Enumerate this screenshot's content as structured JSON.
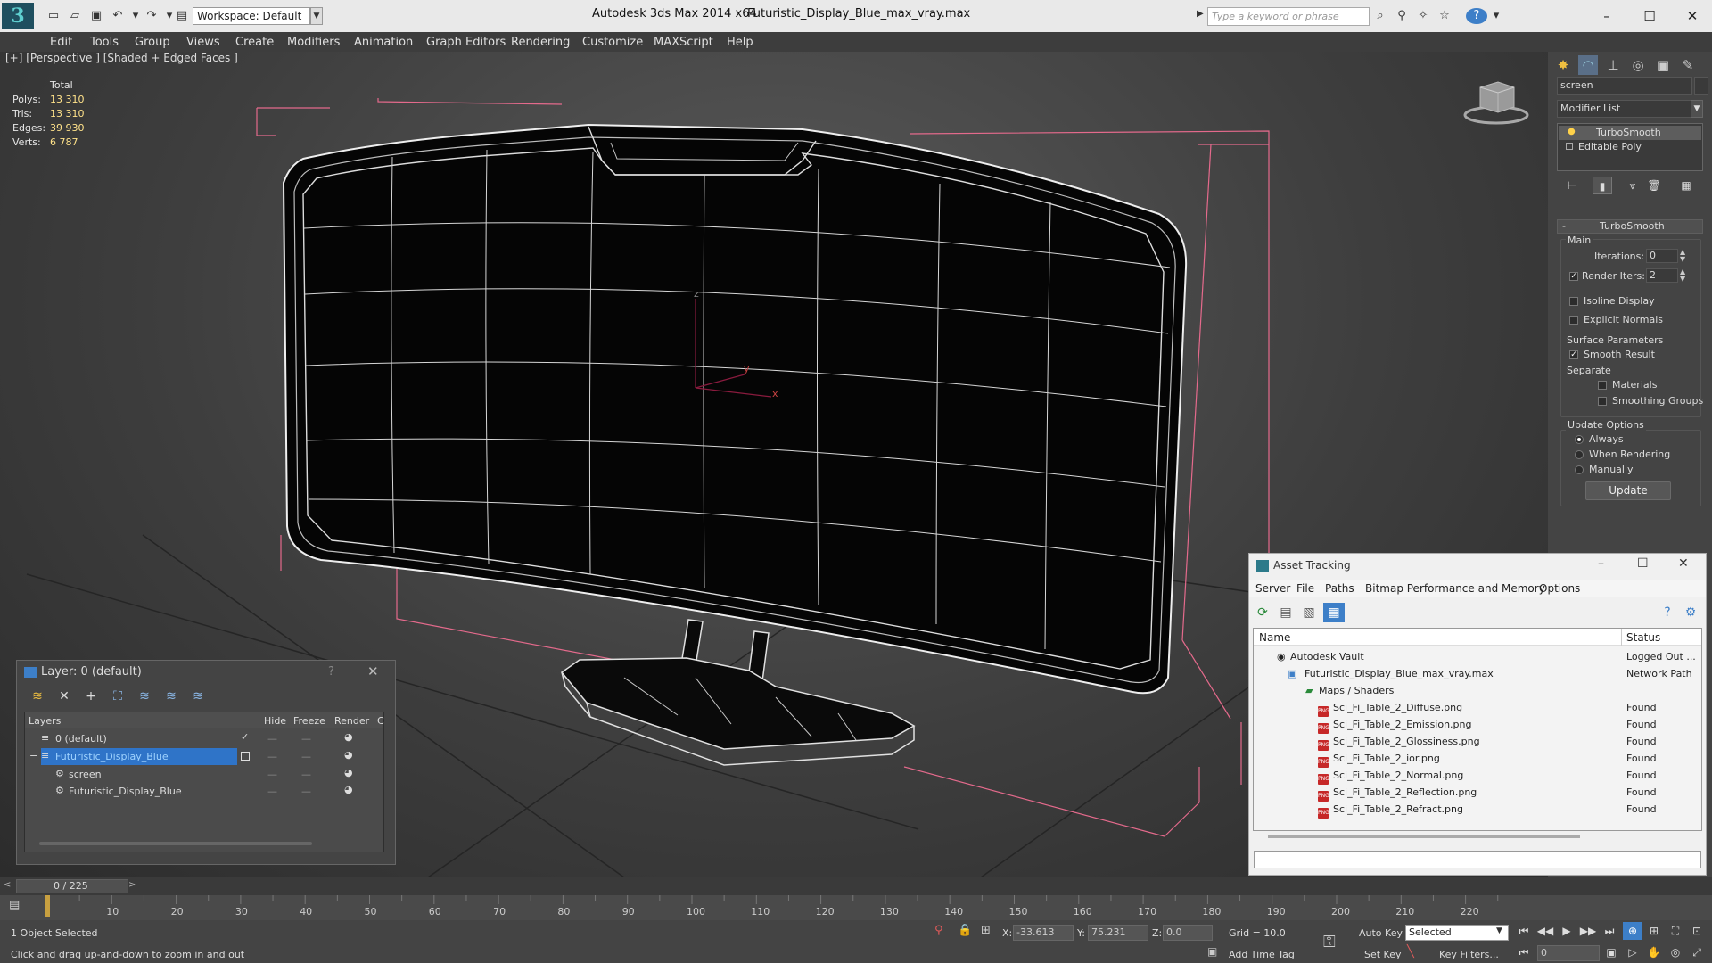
{
  "titlebar": {
    "app_title": "Autodesk 3ds Max  2014 x64",
    "file_title": "Futuristic_Display_Blue_max_vray.max",
    "workspace": "Workspace: Default",
    "search_placeholder": "Type a keyword or phrase",
    "minimize": "–",
    "maximize": "☐",
    "close": "✕"
  },
  "menu": [
    "Edit",
    "Tools",
    "Group",
    "Views",
    "Create",
    "Modifiers",
    "Animation",
    "Graph Editors",
    "Rendering",
    "Customize",
    "MAXScript",
    "Help"
  ],
  "viewport": {
    "label": "[+] [Perspective ] [Shaded + Edged Faces ]",
    "stats": {
      "total_label": "Total",
      "rows": [
        {
          "label": "Polys:",
          "value": "13 310"
        },
        {
          "label": "Tris:",
          "value": "13 310"
        },
        {
          "label": "Edges:",
          "value": "39 930"
        },
        {
          "label": "Verts:",
          "value": "6 787"
        }
      ]
    },
    "axis": {
      "z": "z",
      "y": "y",
      "x": "x"
    }
  },
  "command_panel": {
    "object_name": "screen",
    "modifier_list": "Modifier List",
    "stack": [
      "TurboSmooth",
      "Editable Poly"
    ],
    "rollout_title": "TurboSmooth",
    "main_label": "Main",
    "iterations_label": "Iterations:",
    "iterations_value": "0",
    "render_iters_label": "Render Iters:",
    "render_iters_value": "2",
    "isoline_display": "Isoline Display",
    "explicit_normals": "Explicit Normals",
    "surface_parameters": "Surface Parameters",
    "smooth_result": "Smooth Result",
    "separate": "Separate",
    "materials": "Materials",
    "smoothing_groups": "Smoothing Groups",
    "update_options": "Update Options",
    "always": "Always",
    "when_rendering": "When Rendering",
    "manually": "Manually",
    "update_button": "Update"
  },
  "layer_window": {
    "title": "Layer: 0 (default)",
    "help": "?",
    "close": "✕",
    "columns": [
      "Layers",
      "Hide",
      "Freeze",
      "Render",
      "C"
    ],
    "rows": [
      {
        "name": "0 (default)",
        "selected": false,
        "indent": 0
      },
      {
        "name": "Futuristic_Display_Blue",
        "selected": true,
        "indent": 0
      },
      {
        "name": "screen",
        "selected": false,
        "indent": 1
      },
      {
        "name": "Futuristic_Display_Blue",
        "selected": false,
        "indent": 1
      }
    ]
  },
  "asset_window": {
    "title": "Asset Tracking",
    "menu": [
      "Server",
      "File",
      "Paths",
      "Bitmap Performance and Memory",
      "Options"
    ],
    "col_name": "Name",
    "col_status": "Status",
    "rows": [
      {
        "name": "Autodesk Vault",
        "status": "Logged Out ...",
        "level": 1,
        "icon": "vault"
      },
      {
        "name": "Futuristic_Display_Blue_max_vray.max",
        "status": "Network Path",
        "level": 2,
        "icon": "max"
      },
      {
        "name": "Maps / Shaders",
        "status": "",
        "level": 3,
        "icon": "folder"
      },
      {
        "name": "Sci_Fi_Table_2_Diffuse.png",
        "status": "Found",
        "level": 4,
        "icon": "png"
      },
      {
        "name": "Sci_Fi_Table_2_Emission.png",
        "status": "Found",
        "level": 4,
        "icon": "png"
      },
      {
        "name": "Sci_Fi_Table_2_Glossiness.png",
        "status": "Found",
        "level": 4,
        "icon": "png"
      },
      {
        "name": "Sci_Fi_Table_2_ior.png",
        "status": "Found",
        "level": 4,
        "icon": "png"
      },
      {
        "name": "Sci_Fi_Table_2_Normal.png",
        "status": "Found",
        "level": 4,
        "icon": "png"
      },
      {
        "name": "Sci_Fi_Table_2_Reflection.png",
        "status": "Found",
        "level": 4,
        "icon": "png"
      },
      {
        "name": "Sci_Fi_Table_2_Refract.png",
        "status": "Found",
        "level": 4,
        "icon": "png"
      }
    ]
  },
  "timeline": {
    "frame_counter": "0 / 225",
    "ticks": [
      "10",
      "20",
      "30",
      "40",
      "50",
      "60",
      "70",
      "80",
      "90",
      "100",
      "110",
      "120",
      "130",
      "140",
      "150",
      "160",
      "170",
      "180",
      "190",
      "200",
      "210",
      "220"
    ]
  },
  "status": {
    "selection": "1 Object Selected",
    "prompt": "Click and drag up-and-down to zoom in and out",
    "x_label": "X:",
    "x_value": "-33.613",
    "y_label": "Y:",
    "y_value": "75.231",
    "z_label": "Z:",
    "z_value": "0.0",
    "grid": "Grid = 10.0",
    "add_time_tag": "Add Time Tag",
    "auto_key": "Auto Key",
    "selected_dropdown": "Selected",
    "set_key": "Set Key",
    "key_filters": "Key Filters...",
    "frame_value": "0"
  },
  "colors": {
    "accent": "#3d7fc8",
    "viewport_bg": "#454545",
    "wire": "#f0f0f0",
    "bbox": "#e46a8c"
  }
}
